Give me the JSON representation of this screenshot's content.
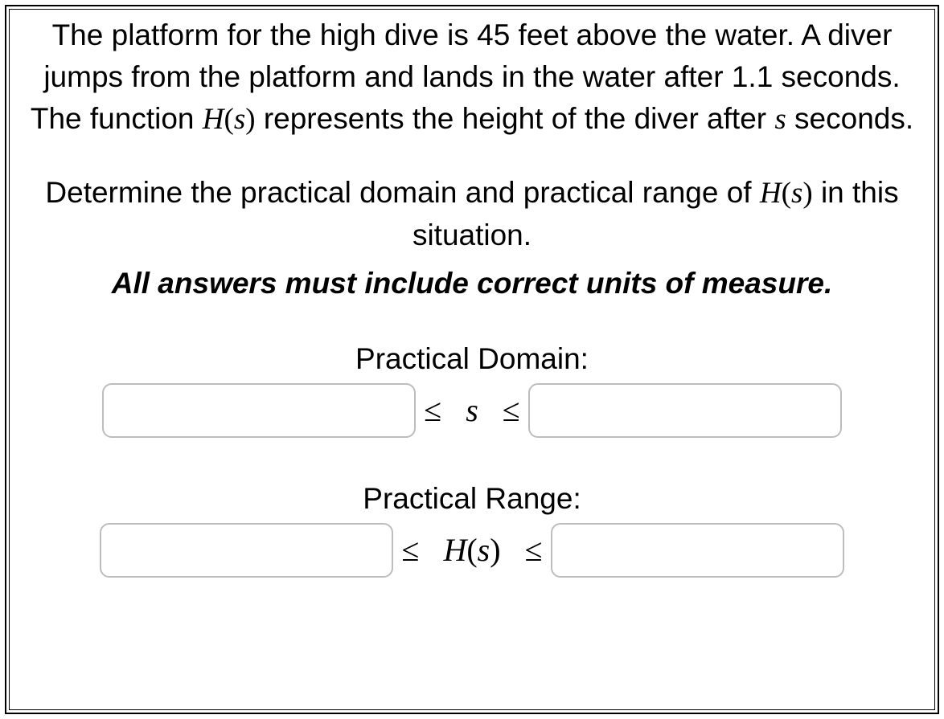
{
  "problem": {
    "paragraph_parts": {
      "a": "The platform for the high dive is 45 feet above the water. A diver jumps from the platform and lands in the water after 1.1 seconds. The function ",
      "fn_H": "H",
      "fn_open": "(",
      "fn_s": "s",
      "fn_close": ")",
      "b": " represents the height of the diver after ",
      "var_s": "s",
      "c": " seconds."
    },
    "instruction_parts": {
      "a": "Determine the practical domain and practical range of ",
      "fn_H": "H",
      "fn_open": "(",
      "fn_s": "s",
      "fn_close": ")",
      "b": " in this situation."
    },
    "emphasis": "All answers must include correct units of measure."
  },
  "domain": {
    "label": "Practical Domain:",
    "lower_value": "",
    "upper_value": "",
    "mid_le1": "≤",
    "mid_var": "s",
    "mid_le2": "≤"
  },
  "range": {
    "label": "Practical Range:",
    "lower_value": "",
    "upper_value": "",
    "mid_le1": "≤",
    "mid_H": "H",
    "mid_open": "(",
    "mid_s": "s",
    "mid_close": ")",
    "mid_le2": "≤"
  }
}
